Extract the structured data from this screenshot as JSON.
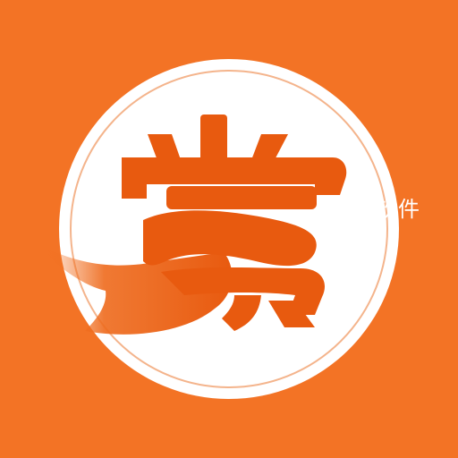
{
  "icon": {
    "background_color": "#f37325",
    "circle_color": "#ffffff",
    "ring_color": "#f4b48c",
    "glyph_color": "#e85a0f",
    "glyph_text": "赏",
    "side_text": "软件"
  }
}
